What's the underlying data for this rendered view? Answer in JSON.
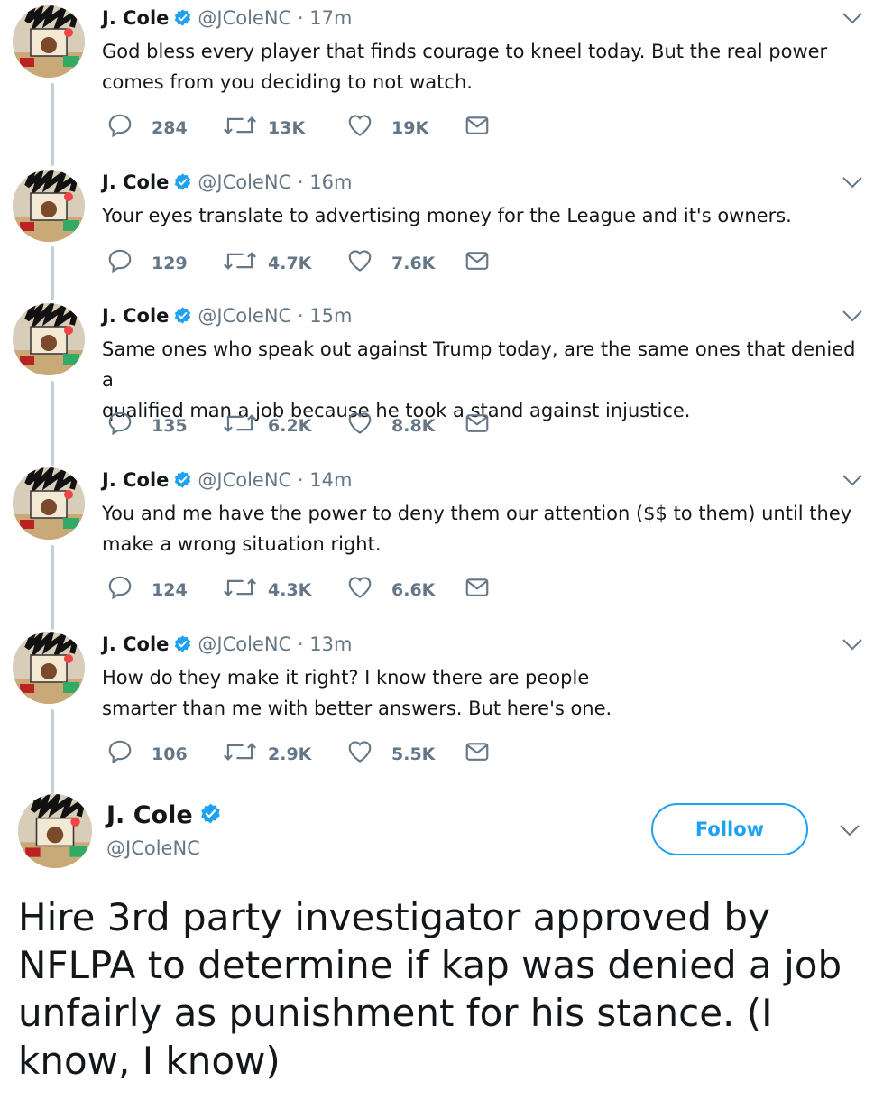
{
  "user": {
    "name": "J. Cole",
    "handle": "@JColeNC",
    "avatar": "profile-avatar",
    "verified_color": "#1da1f2"
  },
  "tweets": [
    {
      "time": "17m",
      "text": "God bless every player that finds courage to kneel today. But the real power\ncomes from you deciding to not watch.",
      "replies": "284",
      "retweets": "13K",
      "likes": "19K"
    },
    {
      "time": "16m",
      "text": "Your eyes translate to advertising money for the League and it's owners.",
      "replies": "129",
      "retweets": "4.7K",
      "likes": "7.6K"
    },
    {
      "time": "15m",
      "text": "Same ones who speak out against Trump today, are the same ones that denied a\nqualified man a job because he took a stand against injustice.",
      "replies": "135",
      "retweets": "6.2K",
      "likes": "8.8K"
    },
    {
      "time": "14m",
      "text": "You and me have the power to deny them our attention ($$ to them) until they\nmake a wrong situation right.",
      "replies": "124",
      "retweets": "4.3K",
      "likes": "6.6K"
    },
    {
      "time": "13m",
      "text": "How do they make it right? I know there are people\nsmarter than me with better answers. But here's one.",
      "replies": "106",
      "retweets": "2.9K",
      "likes": "5.5K"
    }
  ],
  "main_tweet": {
    "follow_label": "Follow",
    "text": "Hire 3rd party investigator approved by NFLPA to determine if kap was denied a job unfairly as punishment for his stance.  (I know, I know)"
  },
  "icons": {
    "reply": "reply-icon",
    "retweet": "retweet-icon",
    "like": "heart-icon",
    "dm": "envelope-icon",
    "caret": "chevron-down-icon",
    "verified": "verified-badge-icon"
  },
  "colors": {
    "text": "#14171a",
    "muted": "#657786",
    "accent": "#1da1f2",
    "line": "#c4cfd6"
  }
}
